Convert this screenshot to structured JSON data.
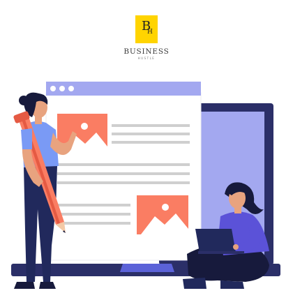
{
  "logo": {
    "monogram_main": "B",
    "monogram_sub": "H",
    "name": "BUSINESS",
    "tagline": "HUSTLE"
  },
  "colors": {
    "logo_yellow": "#ffd400",
    "window_bar": "#a3a8f0",
    "laptop_frame": "#2b2f68",
    "laptop_screen": "#a3a8f0",
    "image_placeholder": "#fa7d63",
    "text_line": "#cfcfcf",
    "shirt_blue": "#7a9af5",
    "shirt_purple": "#5b52d8",
    "hair": "#171a3c",
    "skin": "#e8a37f",
    "pants": "#21295c"
  },
  "scene": {
    "icons": [
      "browser-window-icon",
      "image-placeholder-icon",
      "pencil-icon",
      "laptop-icon"
    ],
    "people": [
      "woman-with-pencil",
      "woman-with-laptop"
    ]
  }
}
